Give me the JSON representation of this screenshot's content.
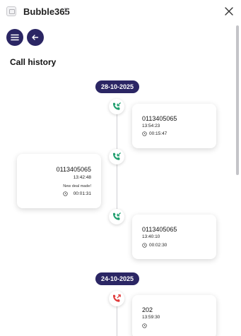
{
  "app": {
    "title": "Bubble365"
  },
  "page": {
    "title": "Call history"
  },
  "groups": [
    {
      "date": "28-10-2025",
      "calls": [
        {
          "number": "0113405065",
          "time": "13:54:23",
          "note": "",
          "duration": "00:15:47",
          "direction": "incoming"
        },
        {
          "number": "0113405065",
          "time": "13:42:48",
          "note": "New deal made!",
          "duration": "00:01:31",
          "direction": "incoming"
        },
        {
          "number": "0113405065",
          "time": "13:40:10",
          "note": "",
          "duration": "00:02:30",
          "direction": "incoming"
        }
      ]
    },
    {
      "date": "24-10-2025",
      "calls": [
        {
          "number": "202",
          "time": "13:59:30",
          "note": "",
          "duration": "",
          "direction": "missed"
        }
      ]
    }
  ],
  "colors": {
    "primary": "#2b2664",
    "incoming": "#1f9e6e",
    "missed": "#e03a3a"
  },
  "icons": {
    "menu": "hamburger-menu-icon",
    "back": "arrow-left-icon",
    "close": "close-icon",
    "incoming": "incoming-call-icon",
    "missed": "missed-call-icon",
    "duration": "clock-icon"
  }
}
